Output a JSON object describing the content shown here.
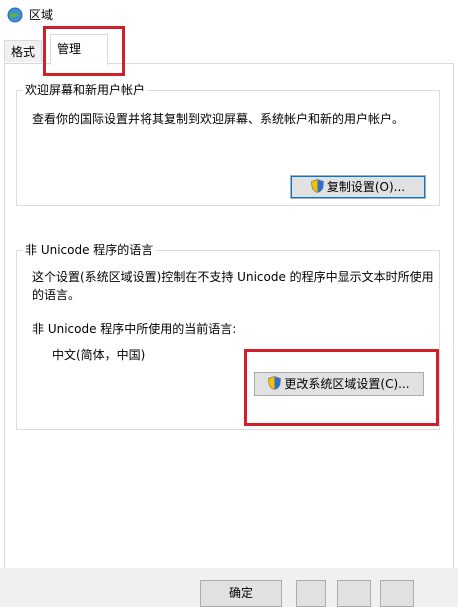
{
  "window": {
    "title": "区域"
  },
  "tabs": [
    {
      "label": "格式",
      "selected": false
    },
    {
      "label": "管理",
      "selected": true
    }
  ],
  "welcome_group": {
    "title": "欢迎屏幕和新用户帐户",
    "description": "查看你的国际设置并将其复制到欢迎屏幕、系统帐户和新的用户帐户。",
    "copy_button": "复制设置(O)..."
  },
  "unicode_group": {
    "title": "非 Unicode 程序的语言",
    "description": "这个设置(系统区域设置)控制在不支持 Unicode 的程序中显示文本时所使用的语言。",
    "current_label": "非 Unicode 程序中所使用的当前语言:",
    "current_value": "中文(简体，中国)",
    "change_button": "更改系统区域设置(C)..."
  },
  "footer": {
    "ok_button": "确定"
  },
  "colors": {
    "highlight": "#d0202a",
    "focus": "#0078d7",
    "button_bg": "#e1e1e1"
  }
}
